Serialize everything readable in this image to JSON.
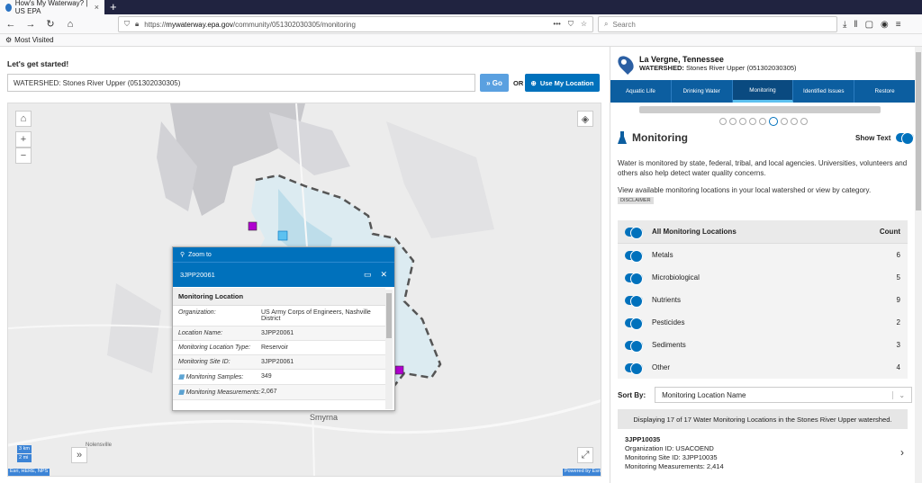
{
  "browser": {
    "tab_title": "How's My Waterway? | US EPA",
    "tab_close": "×",
    "new_tab": "+",
    "url_host": "mywaterway.epa.gov",
    "url_prefix": "https://",
    "url_path": "/community/051302030305/monitoring",
    "search_placeholder": "Search",
    "bookmark": "Most Visited"
  },
  "search": {
    "title": "Let's get started!",
    "value": "WATERSHED: Stones River Upper (051302030305)",
    "go_label": "Go",
    "or_label": "OR",
    "location_label": "Use My Location"
  },
  "map": {
    "place_smyrna": "Smyrna",
    "place_nolensville": "Nolensville",
    "scale_km": "3 km",
    "scale_mi": "2 mi",
    "attribution": "Esri, HERE, NPS",
    "powered": "Powered by Esri"
  },
  "popup": {
    "zoom_label": "Zoom to",
    "site": "3JPP20061",
    "section_title": "Monitoring Location",
    "rows": [
      {
        "k": "Organization:",
        "v": "US Army Corps of Engineers, Nashville District"
      },
      {
        "k": "Location Name:",
        "v": "3JPP20061"
      },
      {
        "k": "Monitoring Location Type:",
        "v": "Reservoir"
      },
      {
        "k": "Monitoring Site ID:",
        "v": "3JPP20061"
      },
      {
        "k": "Monitoring Samples:",
        "v": "349"
      },
      {
        "k": "Monitoring Measurements:",
        "v": "2,067"
      }
    ]
  },
  "panel": {
    "city": "La Vergne, Tennessee",
    "watershed_label": "WATERSHED:",
    "watershed_value": "Stones River Upper (051302030305)",
    "tabs": [
      "Aquatic Life",
      "Drinking Water",
      "Monitoring",
      "Identified Issues",
      "Restore"
    ],
    "section_title": "Monitoring",
    "show_text": "Show Text",
    "desc1": "Water is monitored by state, federal, tribal, and local agencies. Universities, volunteers and others also help detect water quality concerns.",
    "desc2": "View available monitoring locations in your local watershed or view by category.",
    "disclaimer": "DISCLAIMER",
    "table_header_name": "All Monitoring Locations",
    "table_header_count": "Count",
    "categories": [
      {
        "name": "Metals",
        "count": "6"
      },
      {
        "name": "Microbiological",
        "count": "5"
      },
      {
        "name": "Nutrients",
        "count": "9"
      },
      {
        "name": "Pesticides",
        "count": "2"
      },
      {
        "name": "Sediments",
        "count": "3"
      },
      {
        "name": "Other",
        "count": "4"
      }
    ],
    "sort_label": "Sort By:",
    "sort_value": "Monitoring Location Name",
    "displaying": "Displaying 17 of 17 Water Monitoring Locations in the Stones River Upper watershed.",
    "result": {
      "name": "3JPP10035",
      "org": "Organization ID: USACOEND",
      "site": "Monitoring Site ID: 3JPP10035",
      "meas": "Monitoring Measurements: 2,414"
    }
  },
  "colors": {
    "brand": "#0071bc",
    "tabs": "#0c5ea0",
    "marker": "#b000d0"
  }
}
